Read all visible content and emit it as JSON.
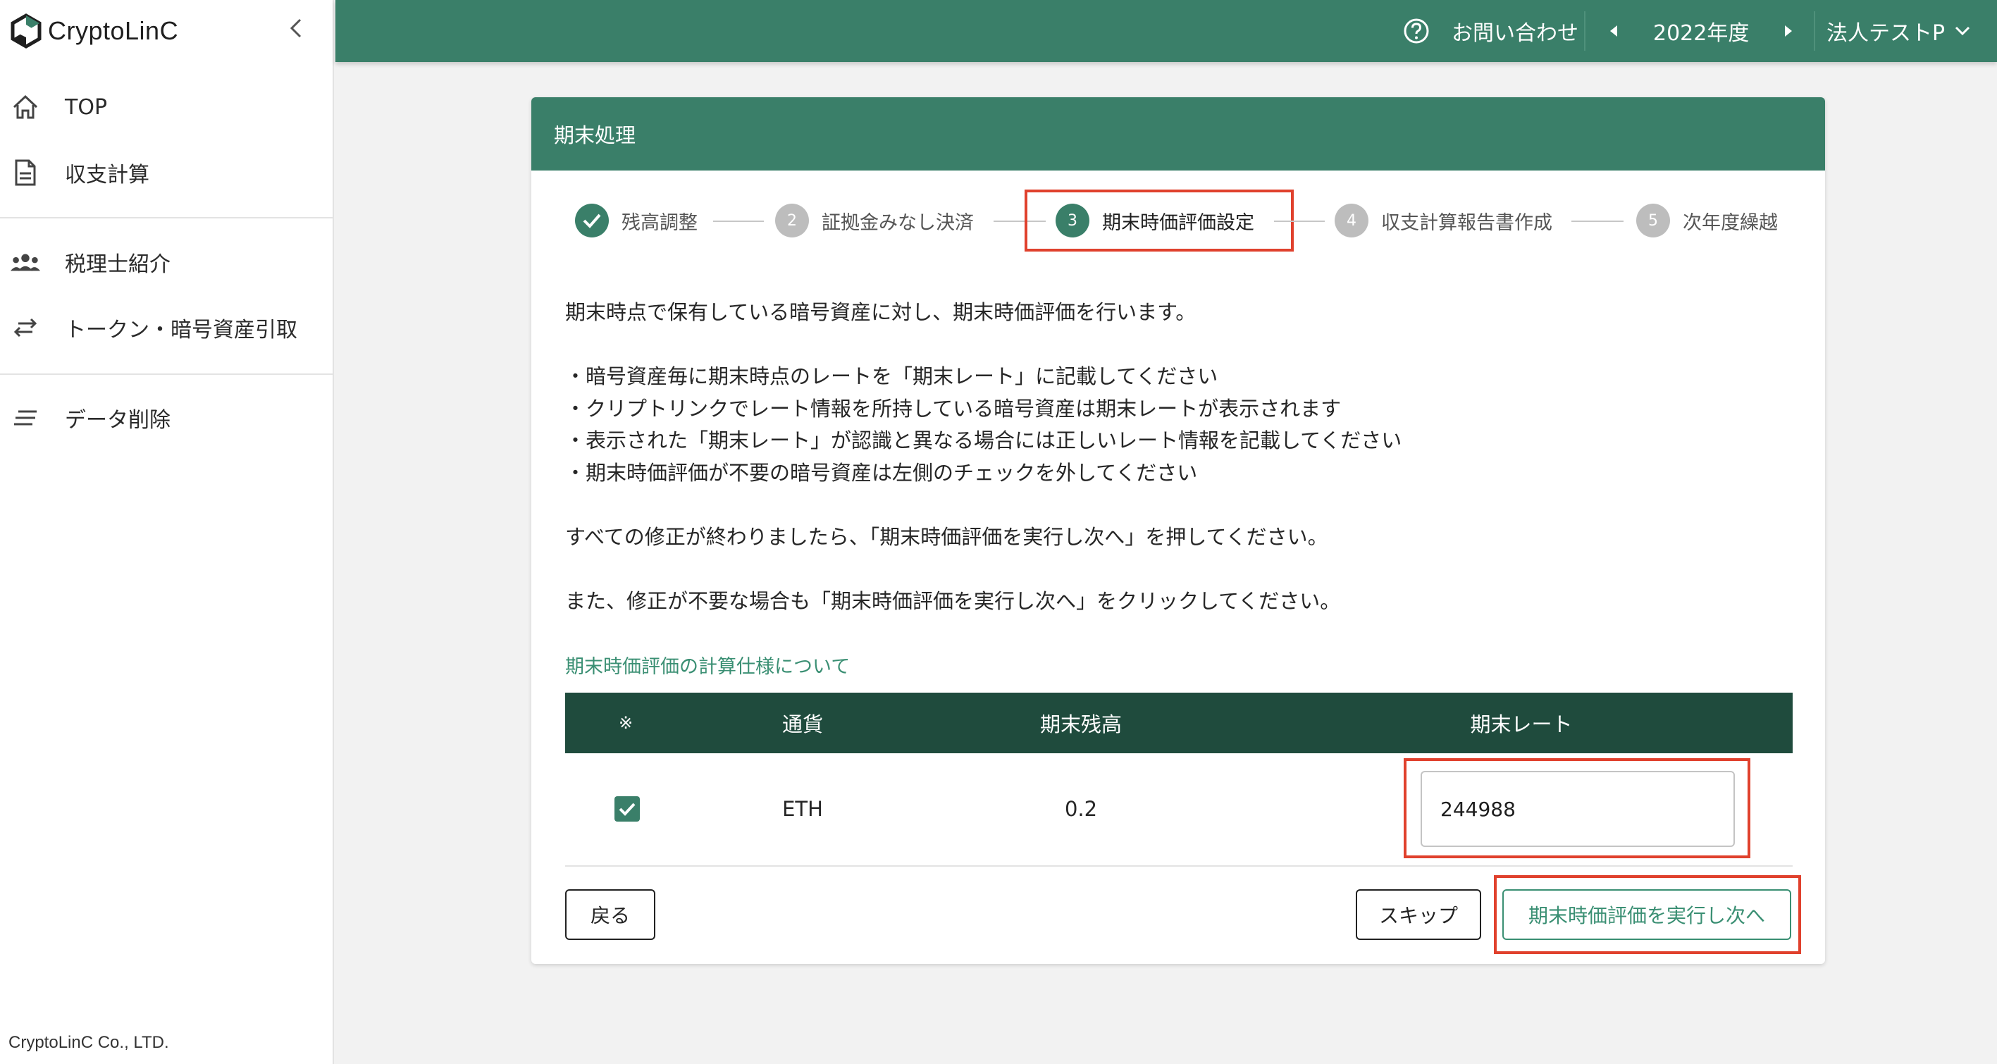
{
  "app": {
    "name": "CryptoLinC",
    "company_footer": "CryptoLinC Co., LTD.",
    "accent_color": "#3a7f69",
    "highlight_color": "#e0412d"
  },
  "sidebar": {
    "items": [
      {
        "label": "TOP",
        "icon": "home-icon"
      },
      {
        "label": "収支計算",
        "icon": "document-icon"
      },
      {
        "label": "税理士紹介",
        "icon": "people-icon"
      },
      {
        "label": "トークン・暗号資産引取",
        "icon": "swap-arrows-icon"
      },
      {
        "label": "データ削除",
        "icon": "lines-icon"
      }
    ]
  },
  "header": {
    "contact": "お問い合わせ",
    "fiscal_year": "2022年度",
    "company": "法人テストP"
  },
  "card": {
    "title": "期末処理",
    "steps": [
      {
        "number": "1",
        "label": "残高調整",
        "state": "done"
      },
      {
        "number": "2",
        "label": "証拠金みなし決済",
        "state": "pending"
      },
      {
        "number": "3",
        "label": "期末時価評価設定",
        "state": "active"
      },
      {
        "number": "4",
        "label": "収支計算報告書作成",
        "state": "pending"
      },
      {
        "number": "5",
        "label": "次年度繰越",
        "state": "pending"
      }
    ],
    "description": [
      "期末時点で保有している暗号資産に対し、期末時価評価を行います。",
      "・暗号資産毎に期末時点のレートを「期末レート」に記載してください",
      "・クリプトリンクでレート情報を所持している暗号資産は期末レートが表示されます",
      "・表示された「期末レート」が認識と異なる場合には正しいレート情報を記載してください",
      "・期末時価評価が不要の暗号資産は左側のチェックを外してください",
      "すべての修正が終わりましたら、「期末時価評価を実行し次へ」を押してください。",
      "また、修正が不要な場合も「期末時価評価を実行し次へ」をクリックしてください。"
    ],
    "spec_link": "期末時価評価の計算仕様について",
    "table": {
      "headers": [
        "※",
        "通貨",
        "期末残高",
        "期末レート"
      ],
      "rows": [
        {
          "checked": true,
          "currency": "ETH",
          "balance": "0.2",
          "rate": "244988"
        }
      ]
    },
    "buttons": {
      "back": "戻る",
      "skip": "スキップ",
      "execute_next": "期末時価評価を実行し次へ"
    }
  }
}
